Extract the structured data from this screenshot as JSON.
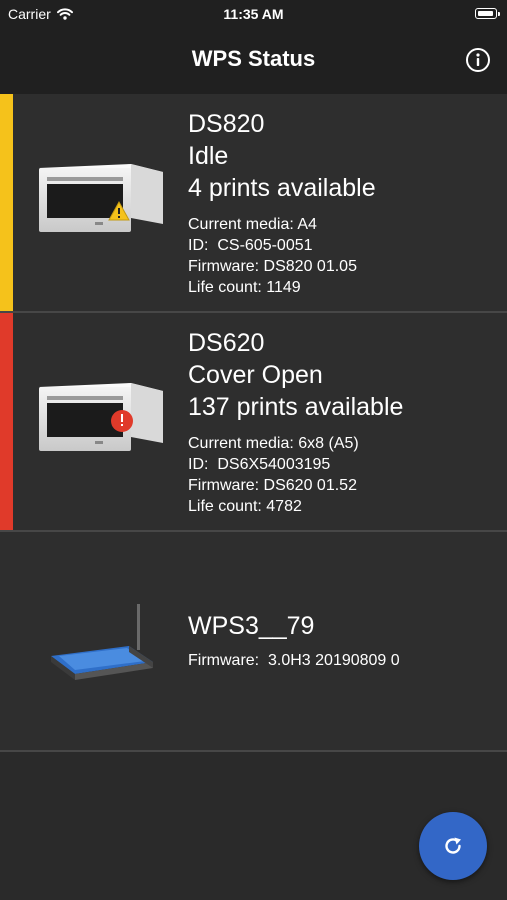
{
  "status_bar": {
    "carrier": "Carrier",
    "time": "11:35 AM"
  },
  "nav": {
    "title": "WPS Status",
    "info_icon": "info-icon"
  },
  "devices": [
    {
      "name": "DS820",
      "status": "Idle",
      "prints": "4 prints available",
      "accent_color": "#f5c21b",
      "alert_icon": "warning-triangle-icon",
      "alert_color": "#f5c21b",
      "details": [
        "Current media: A4",
        "ID:  CS-605-0051",
        "Firmware: DS820 01.05",
        "Life count: 1149"
      ]
    },
    {
      "name": "DS620",
      "status": "Cover Open",
      "prints": "137 prints available",
      "accent_color": "#e03a2a",
      "alert_icon": "error-circle-icon",
      "alert_color": "#e03a2a",
      "details": [
        "Current media: 6x8 (A5)",
        "ID:  DS6X54003195",
        "Firmware: DS620 01.52",
        "Life count: 4782"
      ]
    },
    {
      "name": "WPS3__79",
      "details": [
        "Firmware:  3.0H3 20190809 0"
      ]
    }
  ],
  "refresh_button": {
    "icon": "refresh-icon",
    "color": "#3367c7"
  }
}
